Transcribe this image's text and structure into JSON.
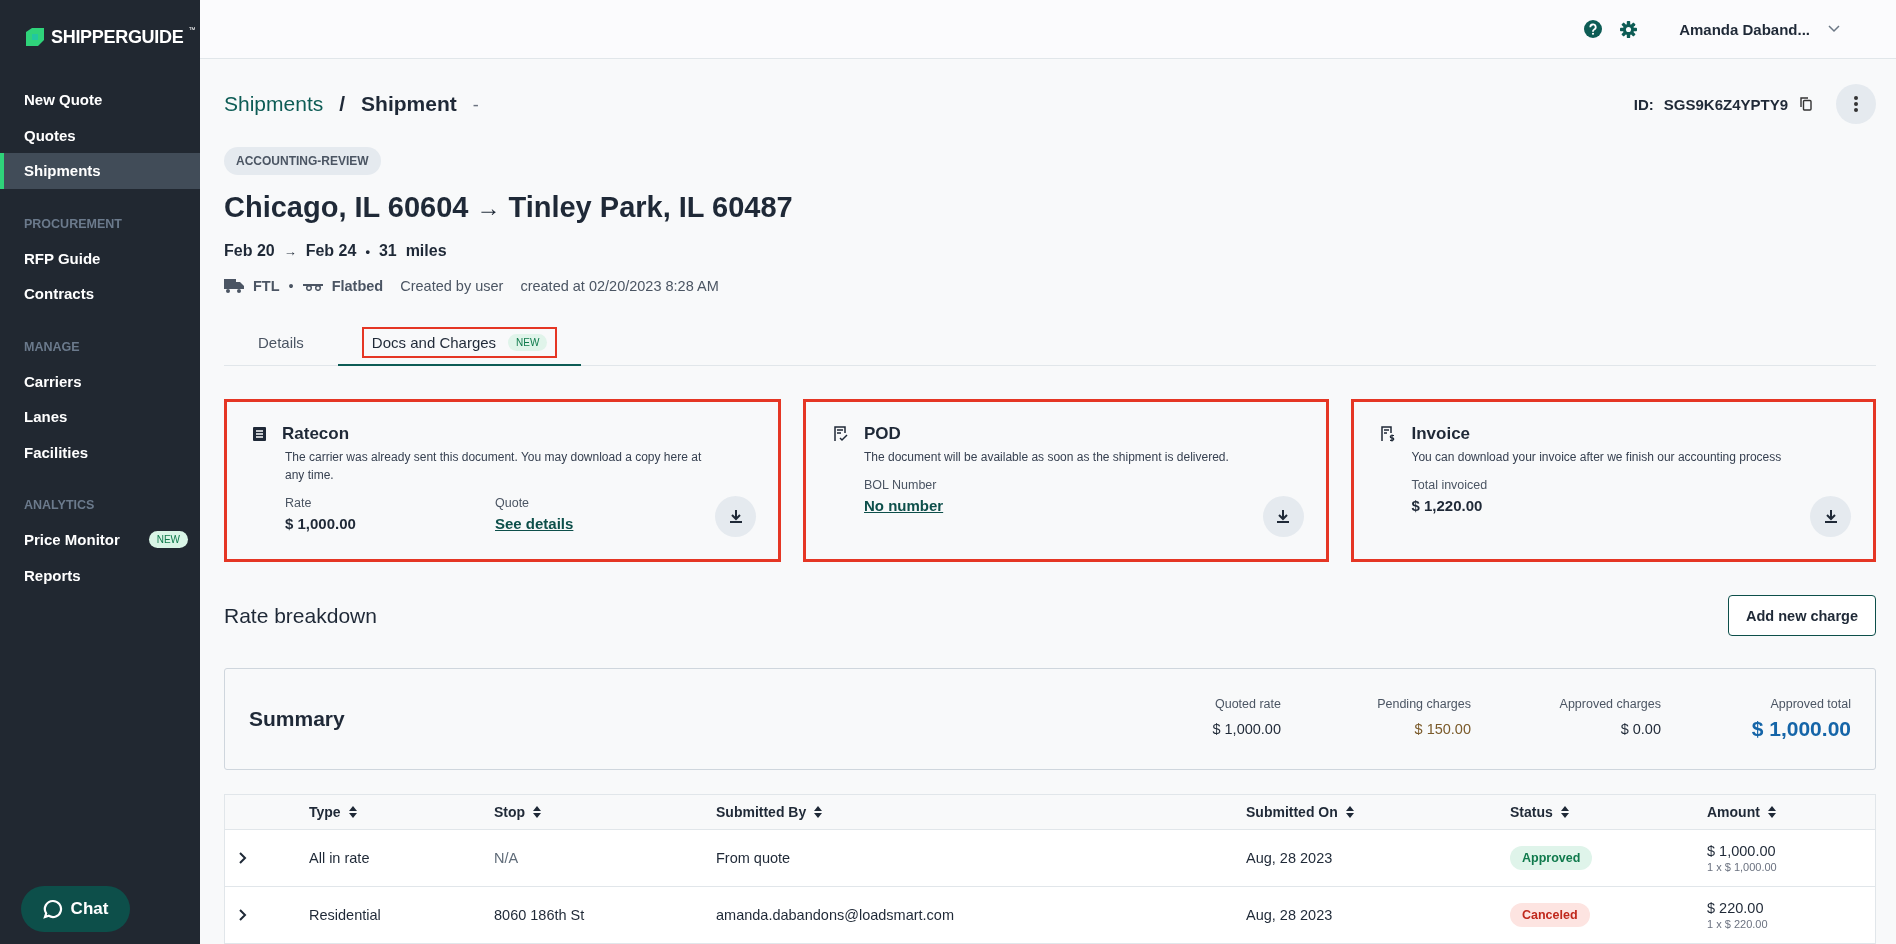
{
  "sidebar": {
    "logo": "SHIPPERGUIDE",
    "logo_mark": "™",
    "sections": [
      {
        "items": [
          {
            "label": "New Quote",
            "selected": false
          },
          {
            "label": "Quotes",
            "selected": false
          },
          {
            "label": "Shipments",
            "selected": true
          }
        ]
      },
      {
        "heading": "PROCUREMENT",
        "items": [
          {
            "label": "RFP Guide",
            "selected": false
          },
          {
            "label": "Contracts",
            "selected": false
          }
        ]
      },
      {
        "heading": "MANAGE",
        "items": [
          {
            "label": "Carriers",
            "selected": false
          },
          {
            "label": "Lanes",
            "selected": false
          },
          {
            "label": "Facilities",
            "selected": false
          }
        ]
      },
      {
        "heading": "ANALYTICS",
        "items": [
          {
            "label": "Price Monitor",
            "selected": false,
            "badge": "NEW"
          },
          {
            "label": "Reports",
            "selected": false
          }
        ]
      }
    ],
    "chat_button": "Chat"
  },
  "topbar": {
    "user": "Amanda Daband..."
  },
  "breadcrumb": {
    "parent": "Shipments",
    "separator": "/",
    "current": "Shipment",
    "suffix": "-"
  },
  "shipment_id": {
    "label": "ID:",
    "value": "SGS9K6Z4YPTY9"
  },
  "status_badge": "ACCOUNTING-REVIEW",
  "route": {
    "origin": "Chicago, IL 60604",
    "arrow": "→",
    "destination": "Tinley Park, IL 60487"
  },
  "dates": {
    "pickup": "Feb 20",
    "arrow": "→",
    "delivery": "Feb 24",
    "dot": "•",
    "distance": "31  miles"
  },
  "meta": {
    "mode": "FTL",
    "dot": "•",
    "equipment": "Flatbed",
    "created_by": "Created by user",
    "created_at": "created at 02/20/2023 8:28 AM"
  },
  "tabs": [
    {
      "label": "Details",
      "selected": false,
      "highlighted": false
    },
    {
      "label": "Docs and Charges",
      "selected": true,
      "highlighted": true,
      "badge": "NEW"
    }
  ],
  "doc_cards": [
    {
      "kind": "ratecon",
      "title": "Ratecon",
      "description": "The carrier was already sent this document. You may download a copy here at any time.",
      "highlighted": true,
      "fields": [
        {
          "label": "Rate",
          "value": "$ 1,000.00",
          "kind": "text"
        },
        {
          "label": "Quote",
          "value": "See details",
          "kind": "link"
        }
      ]
    },
    {
      "kind": "pod",
      "title": "POD",
      "description": "The document will be available as soon as the shipment is delivered.",
      "highlighted": true,
      "fields": [
        {
          "label": "BOL Number",
          "value": "No number",
          "kind": "link"
        }
      ]
    },
    {
      "kind": "invoice",
      "title": "Invoice",
      "description": "You can download your invoice after we finish our accounting process",
      "highlighted": true,
      "fields": [
        {
          "label": "Total invoiced",
          "value": "$ 1,220.00",
          "kind": "text"
        }
      ]
    }
  ],
  "rate_breakdown": {
    "title": "Rate breakdown",
    "add_button": "Add new charge"
  },
  "summary": {
    "title": "Summary",
    "items": [
      {
        "label": "Quoted rate",
        "value": "$ 1,000.00",
        "kind": "plain"
      },
      {
        "label": "Pending charges",
        "value": "$ 150.00",
        "kind": "pending"
      },
      {
        "label": "Approved charges",
        "value": "$ 0.00",
        "kind": "plain"
      },
      {
        "label": "Approved total",
        "value": "$ 1,000.00",
        "kind": "total"
      }
    ]
  },
  "table": {
    "columns": [
      "Type",
      "Stop",
      "Submitted By",
      "Submitted On",
      "Status",
      "Amount"
    ],
    "rows": [
      {
        "expanded": false,
        "type": "All in rate",
        "stop": "N/A",
        "stop_muted": true,
        "submitted_by": "From quote",
        "submitted_on": "Aug, 28 2023",
        "status": {
          "label": "Approved",
          "kind": "approved"
        },
        "amount": "$ 1,000.00",
        "amount_detail": "1 x $ 1,000.00"
      },
      {
        "expanded": false,
        "type": "Residential",
        "stop": "8060 186th St",
        "stop_muted": false,
        "submitted_by": "amanda.dabandons@loadsmart.com",
        "submitted_on": "Aug, 28 2023",
        "status": {
          "label": "Canceled",
          "kind": "canceled"
        },
        "amount": "$ 220.00",
        "amount_detail": "1 x $ 220.00"
      }
    ]
  }
}
